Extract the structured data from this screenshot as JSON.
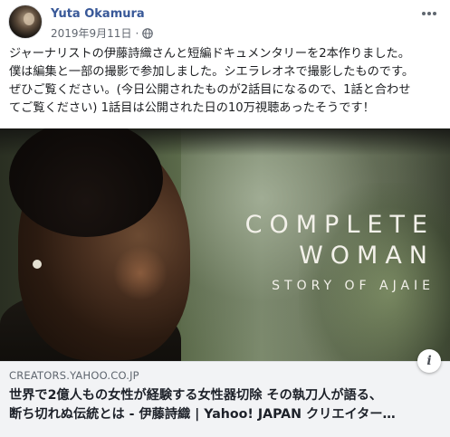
{
  "post": {
    "author": "Yuta Okamura",
    "date": "2019年9月11日",
    "separator": "·",
    "body_lines": [
      "ジャーナリストの伊藤詩織さんと短編ドキュメンタリーを2本作りました。",
      "僕は編集と一部の撮影で参加しました。シエラレオネで撮影したものです。",
      "ぜひご覧ください。(今日公開されたものが2話目になるので、1話と合わせ",
      "てご覧ください) 1話目は公開された日の10万視聴あったそうです！"
    ]
  },
  "media": {
    "title_line1": "COMPLETE",
    "title_line2": "WOMAN",
    "subtitle": "STORY OF AJAIE"
  },
  "link": {
    "domain": "CREATORS.YAHOO.CO.JP",
    "title_lines": [
      "世界で2億人もの女性が経験する女性器切除 その執刀人が語る、",
      "断ち切れぬ伝統とは - 伊藤詩織 | Yahoo! JAPAN クリエイター…"
    ],
    "info_label": "i"
  },
  "icons": {
    "globe": "globe-icon",
    "more": "more-options-icon",
    "info": "info-icon"
  }
}
